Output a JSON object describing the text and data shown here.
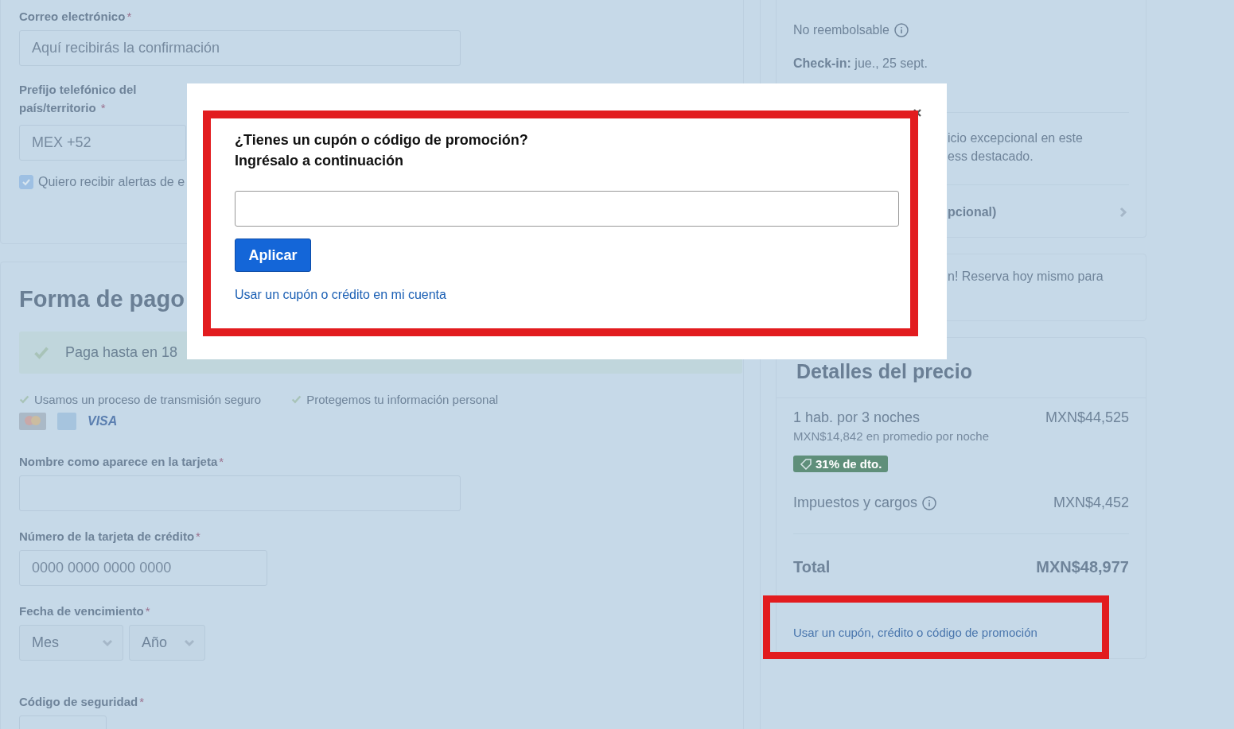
{
  "contact": {
    "email_label": "Correo electrónico",
    "email_placeholder": "Aquí recibirás la confirmación",
    "prefix_label": "Prefijo telefónico del país/territorio",
    "prefix_value": "MEX +52",
    "required_mark": "*",
    "alerts": {
      "label": "Quiero recibir alertas de e",
      "checked": true
    }
  },
  "payment": {
    "title": "Forma de pago",
    "banner": "Paga hasta en 18",
    "assurances": [
      "Usamos un proceso de transmisión seguro",
      "Protegemos tu información personal"
    ],
    "visa": "VISA",
    "fields": [
      {
        "kind": "text",
        "label": "Nombre como aparece en la tarjeta"
      },
      {
        "kind": "card",
        "label": "Número de la tarjeta de crédito",
        "placeholder": "0000 0000 0000 0000"
      },
      {
        "kind": "expiry",
        "label": "Fecha de vencimiento",
        "selects": [
          "Mes",
          "Año"
        ]
      },
      {
        "kind": "cvv",
        "label": "Código de seguridad"
      }
    ]
  },
  "summary": {
    "refund": "No reembolsable",
    "checkin_label": "Check-in:",
    "checkin_value": "jue., 25 sept.",
    "service_lines": [
      "icio excepcional en este",
      "ess destacado."
    ],
    "optional": "pcional)",
    "promo_note": "n! Reserva hoy mismo para"
  },
  "price": {
    "title": "Detalles del precio",
    "rows": [
      {
        "kind": "line",
        "label": "1 hab. por 3 noches",
        "amount": "MXN$44,525",
        "sub": "MXN$14,842 en promedio por noche"
      },
      {
        "kind": "badge",
        "label": "31% de dto."
      },
      {
        "kind": "tax",
        "label": "Impuestos y cargos",
        "amount": "MXN$4,452"
      }
    ],
    "total_label": "Total",
    "total_amount": "MXN$48,977",
    "coupon_link": "Usar un cupón, crédito o código de promoción"
  },
  "modal": {
    "title_lines": [
      "¿Tienes un cupón o código de promoción?",
      "Ingrésalo a continuación"
    ],
    "apply": "Aplicar",
    "account_link": "Usar un cupón o crédito en mi cuenta"
  }
}
